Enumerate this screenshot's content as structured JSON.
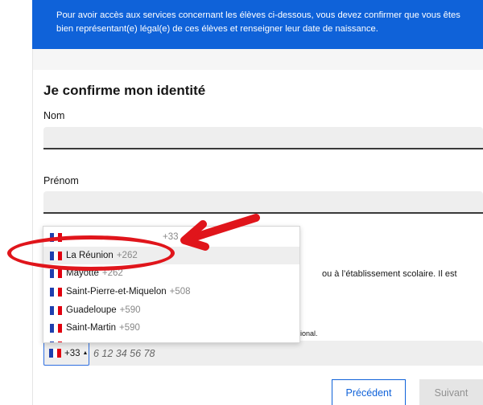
{
  "banner": {
    "text": "Pour avoir accès aux services concernant les élèves ci-dessous, vous devez confirmer que vous êtes bien représentant(e) légal(e) de ces élèves et renseigner leur date de naissance."
  },
  "identity_form": {
    "title": "Je confirme mon identité",
    "last_name_label": "Nom",
    "last_name_value": "",
    "first_name_label": "Prénom",
    "first_name_value": ""
  },
  "obscured_text": {
    "line_establishment": "ou à l’établissement scolaire. Il est",
    "line_national": "ional."
  },
  "phone": {
    "country_code": "+33",
    "caret": "▲",
    "placeholder": "6 12 34 56 78",
    "value": ""
  },
  "country_dropdown": {
    "items": [
      {
        "name": "",
        "code": "+33",
        "flag": "france-flag-icon"
      },
      {
        "name": "La Réunion",
        "code": "+262",
        "flag": "france-flag-icon",
        "highlighted": true
      },
      {
        "name": "Mayotte",
        "code": "+262",
        "flag": "france-flag-icon"
      },
      {
        "name": "Saint-Pierre-et-Miquelon",
        "code": "+508",
        "flag": "france-flag-icon"
      },
      {
        "name": "Guadeloupe",
        "code": "+590",
        "flag": "france-flag-icon"
      },
      {
        "name": "Saint-Martin",
        "code": "+590",
        "flag": "france-flag-icon"
      },
      {
        "name": "",
        "code": "",
        "flag": "france-flag-icon"
      }
    ]
  },
  "buttons": {
    "previous": "Précédent",
    "next": "Suivant"
  },
  "colors": {
    "brand_blue": "#0f62d9",
    "annotation_red": "#e0151b",
    "flag_blue": "#1e3fae",
    "flag_red": "#e1000f"
  }
}
